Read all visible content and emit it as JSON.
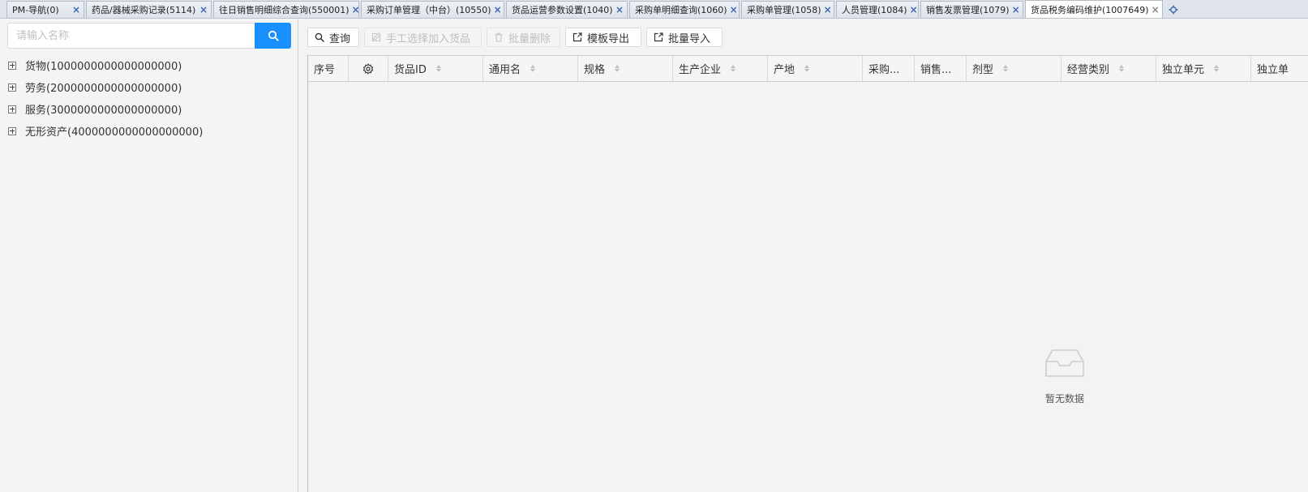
{
  "tabs": [
    {
      "label": "PM-导航(0)",
      "active": false
    },
    {
      "label": "药品/器械采购记录(5114)",
      "active": false
    },
    {
      "label": "往日销售明细综合查询(550001)",
      "active": false
    },
    {
      "label": "采购订单管理（中台）(10550)",
      "active": false
    },
    {
      "label": "货品运营参数设置(1040)",
      "active": false
    },
    {
      "label": "采购单明细查询(1060)",
      "active": false
    },
    {
      "label": "采购单管理(1058)",
      "active": false
    },
    {
      "label": "人员管理(1084)",
      "active": false
    },
    {
      "label": "销售发票管理(1079)",
      "active": false
    },
    {
      "label": "货品税务编码维护(1007649)",
      "active": true
    }
  ],
  "tab_close_glyph": "×",
  "left": {
    "search_placeholder": "请输入名称",
    "tree": [
      {
        "label": "货物(1000000000000000000)"
      },
      {
        "label": "劳务(2000000000000000000)"
      },
      {
        "label": "服务(3000000000000000000)"
      },
      {
        "label": "无形资产(4000000000000000000)"
      }
    ]
  },
  "toolbar": {
    "query": "查询",
    "manual_add": "手工选择加入货品",
    "batch_delete": "批量删除",
    "template_export": "模板导出",
    "batch_import": "批量导入"
  },
  "columns": [
    {
      "label": "序号"
    },
    {
      "label": ""
    },
    {
      "label": "货品ID"
    },
    {
      "label": "通用名"
    },
    {
      "label": "规格"
    },
    {
      "label": "生产企业"
    },
    {
      "label": "产地"
    },
    {
      "label": "采购..."
    },
    {
      "label": "销售..."
    },
    {
      "label": "剂型"
    },
    {
      "label": "经营类别"
    },
    {
      "label": "独立单元"
    },
    {
      "label": "独立单"
    }
  ],
  "empty_text": "暂无数据",
  "colors": {
    "accent": "#1890ff",
    "tab_close": "#3a67b5"
  }
}
